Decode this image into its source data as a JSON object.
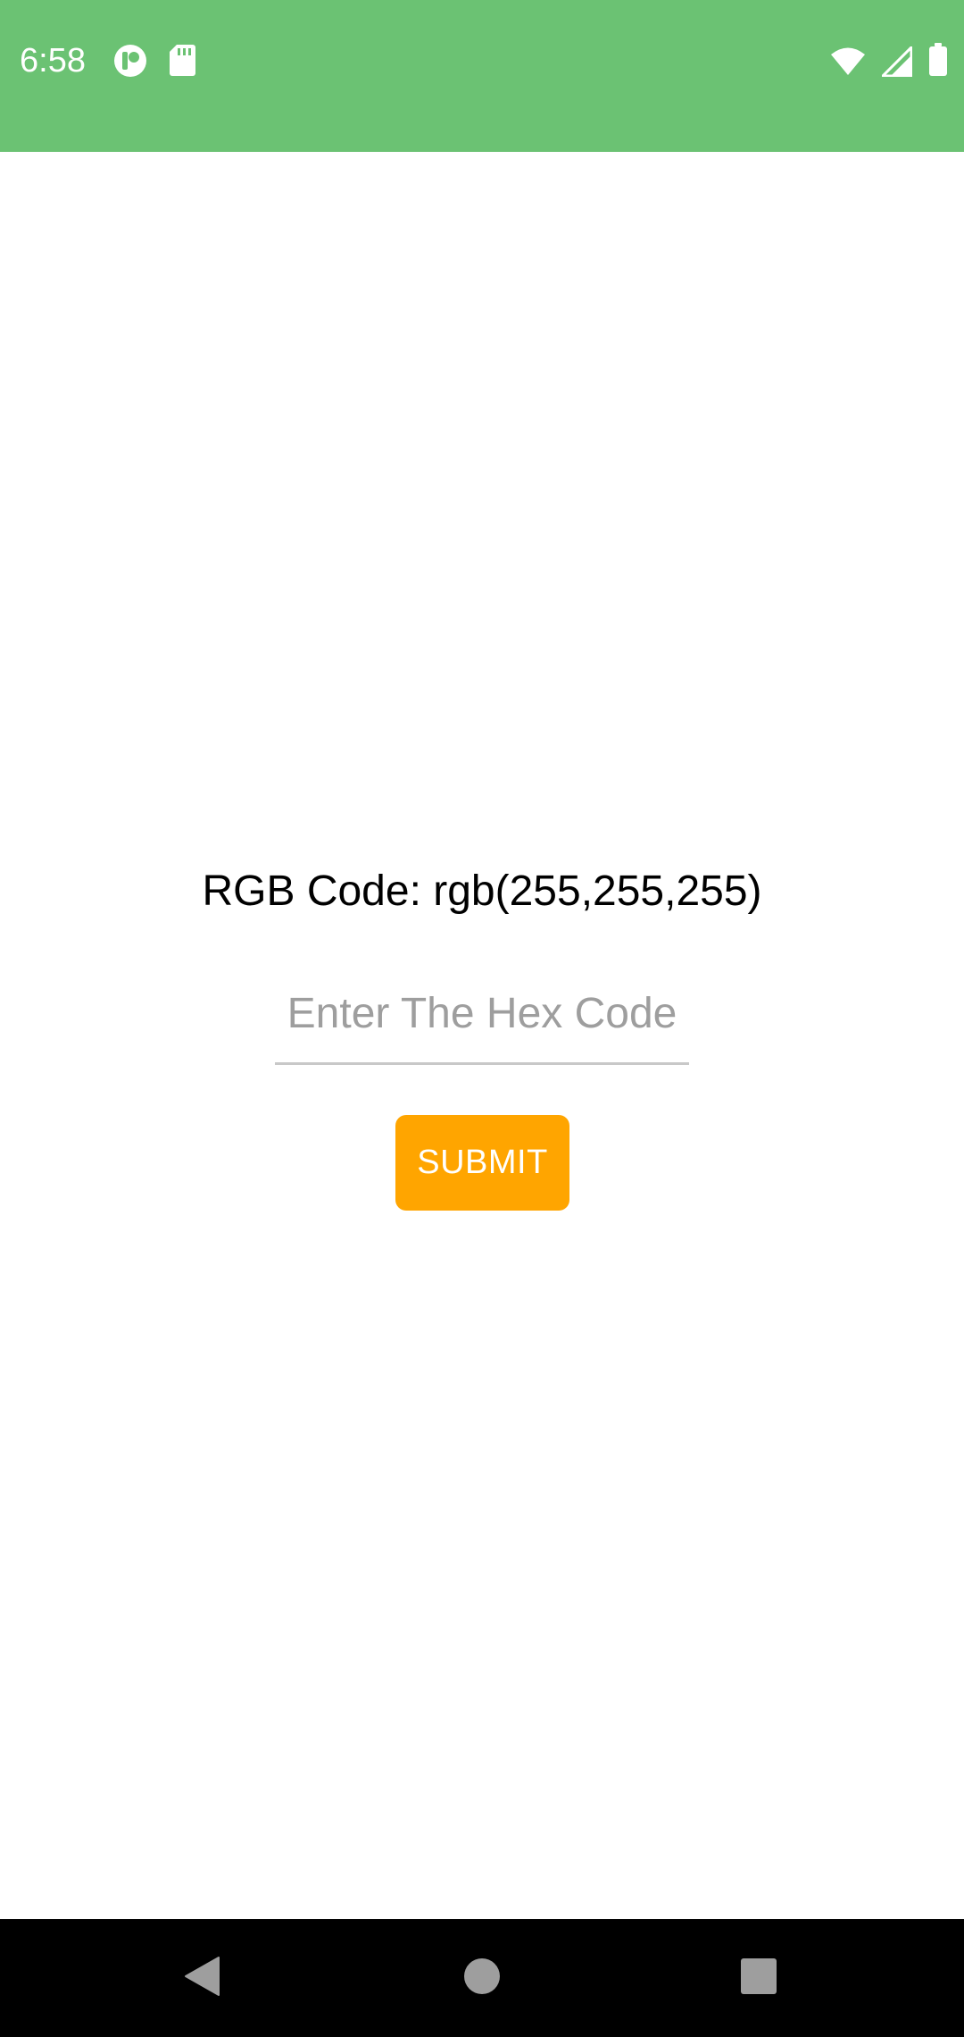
{
  "status_bar": {
    "time": "6:58",
    "color": "#6bc273",
    "left_icons": [
      "app-notification-icon",
      "sd-card-icon"
    ],
    "right_icons": [
      "wifi-icon",
      "cell-signal-icon",
      "battery-icon"
    ]
  },
  "main": {
    "rgb_label": "RGB Code: rgb(255,255,255)",
    "hex_input": {
      "value": "",
      "placeholder": "Enter The Hex Code"
    },
    "submit_label": "SUBMIT",
    "submit_color": "#ffa500"
  },
  "nav_bar": {
    "icons": [
      "back-icon",
      "home-icon",
      "recent-apps-icon"
    ]
  }
}
